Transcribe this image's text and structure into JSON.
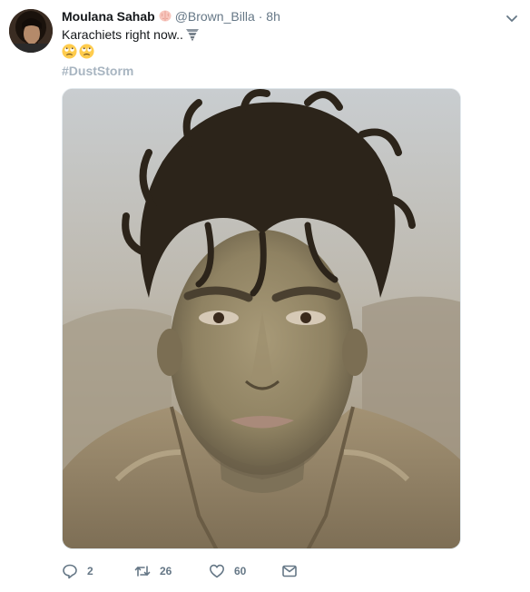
{
  "tweet": {
    "display_name": "Moulana Sahab",
    "handle": "@Brown_Billa",
    "separator": "·",
    "timestamp": "8h",
    "text": "Karachiets right now..",
    "inline_icon": "tornado-emoji",
    "emoji": [
      "face-with-rolling-eyes-emoji",
      "face-with-rolling-eyes-emoji"
    ],
    "hashtag": "#DustStorm",
    "media_description_icon": "photo-of-dust-covered-man",
    "actions": {
      "reply": {
        "icon": "reply-icon",
        "count": "2"
      },
      "retweet": {
        "icon": "retweet-icon",
        "count": "26"
      },
      "like": {
        "icon": "heart-icon",
        "count": "60"
      },
      "message": {
        "icon": "envelope-icon"
      }
    }
  },
  "colors": {
    "text": "#14171a",
    "muted": "#657786",
    "hashtag": "#a8b5c1",
    "border": "#e1e8ed"
  }
}
